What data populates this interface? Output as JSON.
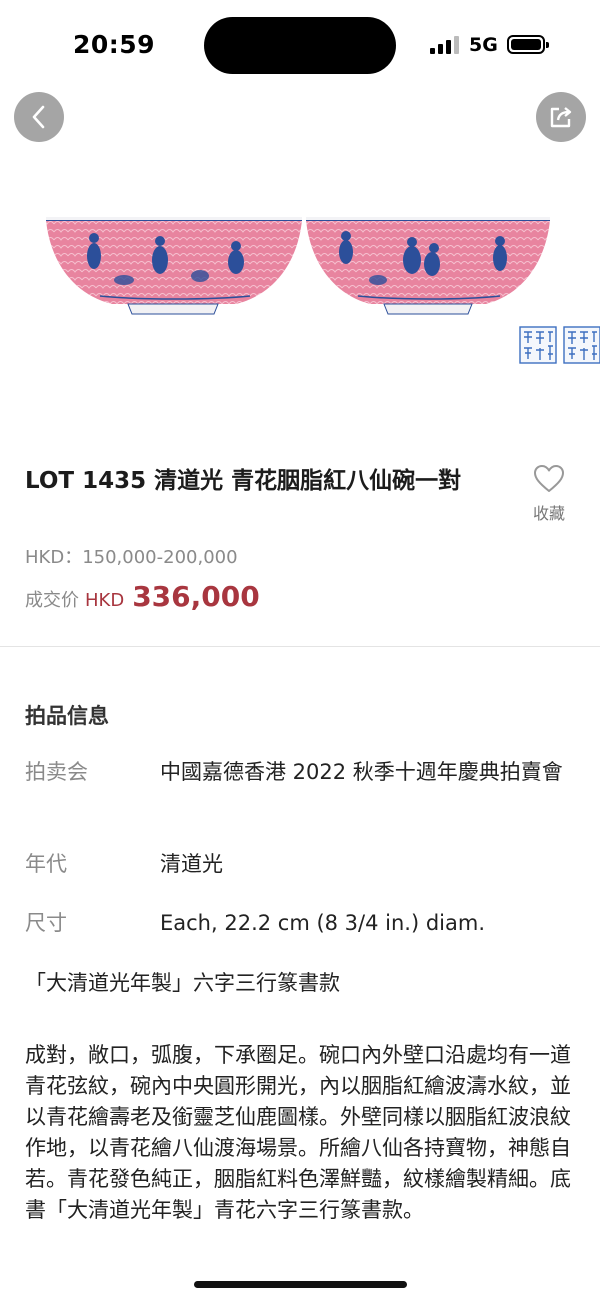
{
  "status_bar": {
    "time": "20:59",
    "network": "5G",
    "signal_icon": "signal-bars-icon",
    "battery_icon": "battery-icon"
  },
  "nav": {
    "back_icon": "chevron-left-icon",
    "share_icon": "share-icon"
  },
  "lot": {
    "title": "LOT 1435 清道光  青花胭脂紅八仙碗一對",
    "favorite_label": "收藏",
    "favorite_icon": "heart-outline-icon",
    "estimate": "HKD：150,000-200,000",
    "sold_label": "成交价",
    "sold_currency": "HKD",
    "sold_price": "336,000"
  },
  "info": {
    "section_title": "拍品信息",
    "rows": [
      {
        "label": "拍卖会",
        "value": "中國嘉德香港 2022 秋季十週年慶典拍賣會"
      },
      {
        "label": "年代",
        "value": "清道光"
      },
      {
        "label": "尺寸",
        "value": "Each, 22.2 cm (8 3/4 in.) diam."
      }
    ],
    "mark_text": "「大清道光年製」六字三行篆書款",
    "description": "成對，敞口，弧腹，下承圈足。碗口內外壁口沿處均有一道青花弦紋，碗內中央圓形開光，內以胭脂紅繪波濤水紋，並以青花繪壽老及銜靈芝仙鹿圖樣。外壁同樣以胭脂紅波浪紋作地，以青花繪八仙渡海場景。所繪八仙各持寶物，神態自若。青花發色純正，胭脂紅料色澤鮮豔，紋樣繪製精細。底書「大清道光年製」青花六字三行篆書款。"
  },
  "colors": {
    "price_red": "#a8363f",
    "muted_gray": "#8a8a8a",
    "bowl_pink": "#e47c9c",
    "blue_white": "#2c4f9a"
  }
}
